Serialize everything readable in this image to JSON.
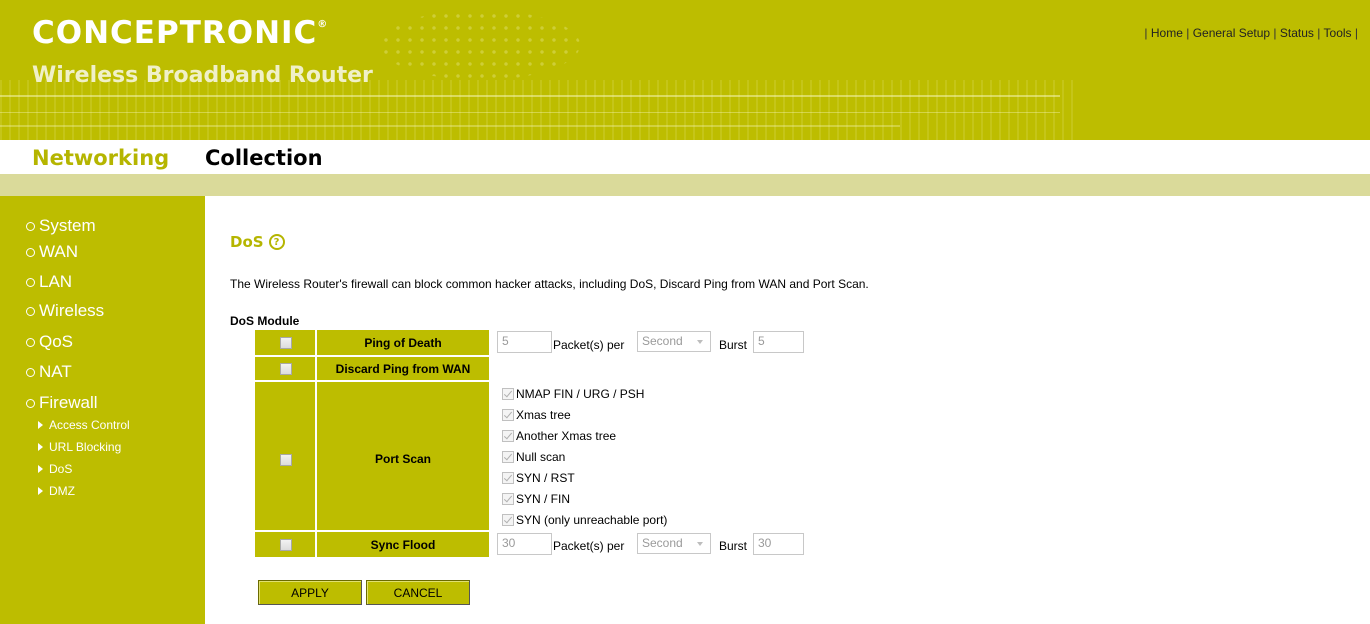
{
  "header": {
    "brand": "CONCEPTRONIC",
    "brand_mark": "®",
    "product": "Wireless Broadband Router",
    "collection_part1": "Networking",
    "collection_part2": "Collection",
    "top_nav": [
      {
        "label": "Home"
      },
      {
        "label": "General Setup"
      },
      {
        "label": "Status"
      },
      {
        "label": "Tools"
      }
    ],
    "separator": "|"
  },
  "sidebar": {
    "items": [
      {
        "label": "System"
      },
      {
        "label": "WAN"
      },
      {
        "label": "LAN"
      },
      {
        "label": "Wireless"
      },
      {
        "label": "QoS"
      },
      {
        "label": "NAT"
      },
      {
        "label": "Firewall"
      }
    ],
    "firewall_subitems": [
      {
        "label": "Access Control"
      },
      {
        "label": "URL Blocking"
      },
      {
        "label": "DoS"
      },
      {
        "label": "DMZ"
      }
    ]
  },
  "main": {
    "title": "DoS",
    "help_icon": "?",
    "description": "The Wireless Router's firewall can block common hacker attacks, including DoS, Discard Ping from WAN and Port Scan.",
    "module_label": "DoS Module",
    "rows": {
      "ping_of_death": {
        "label": "Ping of Death",
        "packets_value": "5",
        "packets_text": "Packet(s) per",
        "unit": "Second",
        "burst_label": "Burst",
        "burst_value": "5"
      },
      "discard_ping": {
        "label": "Discard Ping from WAN"
      },
      "port_scan": {
        "label": "Port Scan",
        "options": [
          "NMAP FIN / URG / PSH",
          "Xmas tree",
          "Another Xmas tree",
          "Null scan",
          "SYN / RST",
          "SYN / FIN",
          "SYN (only unreachable port)"
        ]
      },
      "sync_flood": {
        "label": "Sync Flood",
        "packets_value": "30",
        "packets_text": "Packet(s) per",
        "unit": "Second",
        "burst_label": "Burst",
        "burst_value": "30"
      }
    },
    "buttons": {
      "apply": "APPLY",
      "cancel": "CANCEL"
    }
  },
  "colors": {
    "olive": "#bdbd00",
    "stripe": "#dada9a"
  }
}
